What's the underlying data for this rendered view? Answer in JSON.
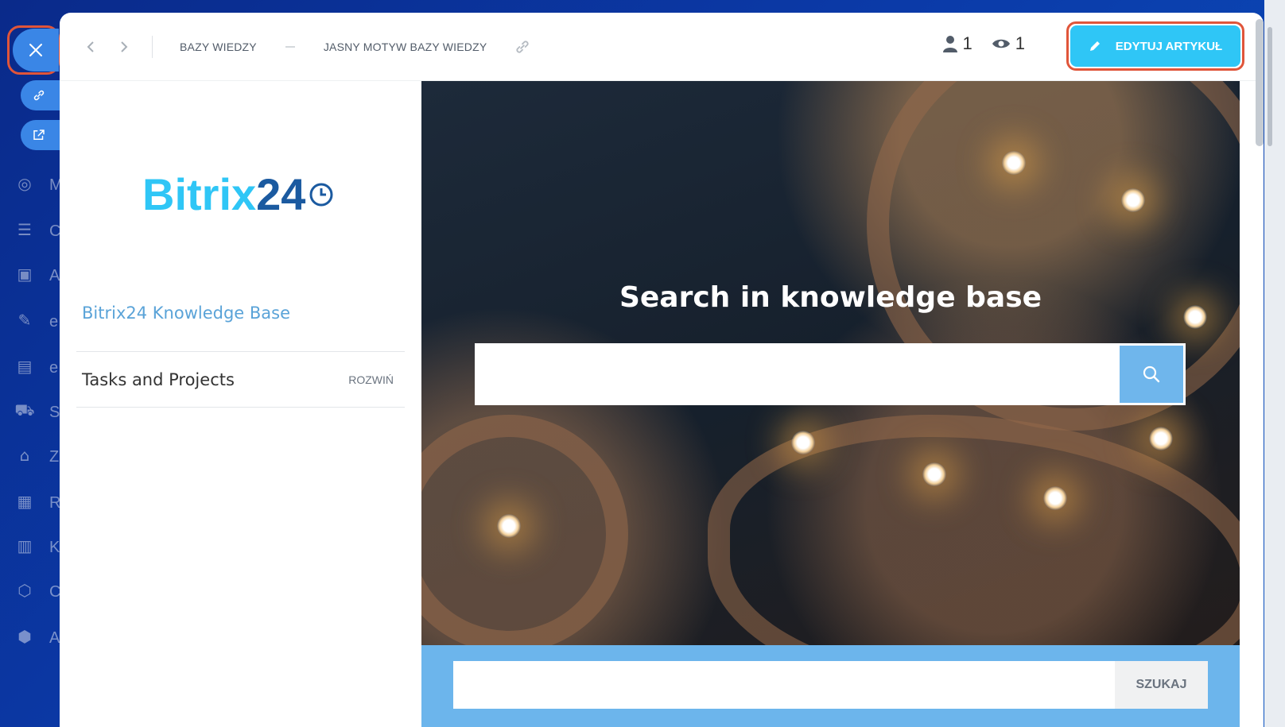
{
  "colors": {
    "accent": "#2fc6f6",
    "highlight": "#e0553a",
    "link": "#5aa3d8",
    "search_bar": "#6cb5ec"
  },
  "slider": {
    "close_icon": "close-icon",
    "side_buttons": [
      {
        "name": "copy-link-icon"
      },
      {
        "name": "open-new-window-icon"
      }
    ]
  },
  "topbar": {
    "breadcrumbs": [
      "BAZY WIEDZY",
      "JASNY MOTYW BAZY WIEDZY"
    ],
    "stats": {
      "users": "1",
      "views": "1"
    },
    "edit_label": "EDYTUJ ARTYKUŁ"
  },
  "sidebar": {
    "logo_part1": "Bitrix",
    "logo_part2": "24",
    "kb_link": "Bitrix24 Knowledge Base",
    "menu": [
      {
        "title": "Tasks and Projects",
        "action": "ROZWIŃ"
      }
    ]
  },
  "hero": {
    "title": "Search in knowledge base",
    "search_value": ""
  },
  "bottom_search": {
    "value": "",
    "button": "SZUKAJ"
  }
}
